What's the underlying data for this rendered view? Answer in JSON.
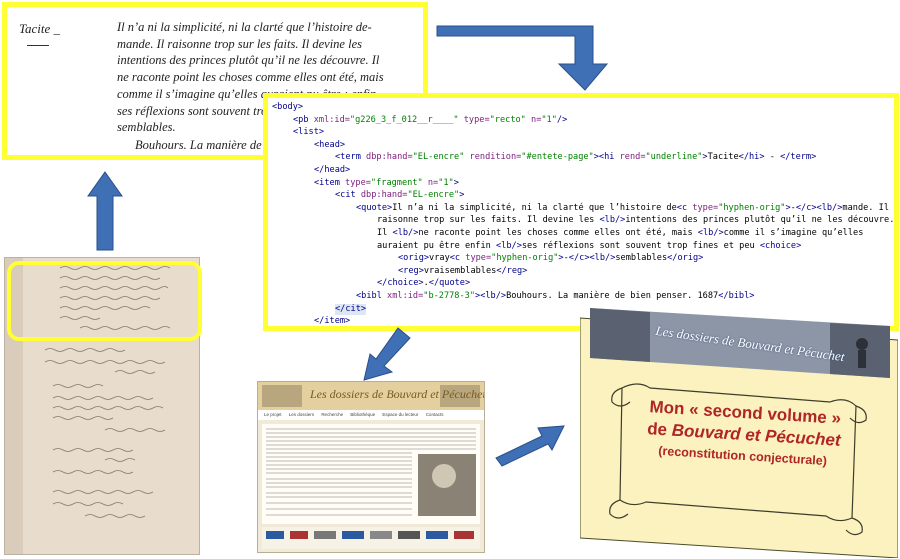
{
  "transcription": {
    "heading": "Tacite _",
    "lines": [
      "Il n’a ni la simplicité, ni la clarté que l’histoire de-",
      "mande. Il raisonne trop sur les faits. Il devine les",
      "intentions des princes plutôt qu’il ne les découvre. Il",
      "ne raconte point les choses comme elles ont été, mais",
      "comme il s’imagine qu’elles auraient pu être ; enfin",
      "ses réflexions sont souvent trop fines et peu vrai-",
      "semblables."
    ],
    "signature": "Bouhours.    La manière de bien penser."
  },
  "xml": {
    "lines": [
      {
        "indent": 0,
        "parts": [
          [
            "tag",
            "<body>"
          ]
        ]
      },
      {
        "indent": 1,
        "parts": [
          [
            "tag",
            "<pb "
          ],
          [
            "an",
            "xml:id="
          ],
          [
            "av",
            "\"g226_3_f_012__r____\""
          ],
          [
            "an",
            " type="
          ],
          [
            "av",
            "\"recto\""
          ],
          [
            "an",
            " n="
          ],
          [
            "av",
            "\"1\""
          ],
          [
            "tag",
            "/>"
          ]
        ]
      },
      {
        "indent": 1,
        "parts": [
          [
            "tag",
            "<list>"
          ]
        ]
      },
      {
        "indent": 2,
        "parts": [
          [
            "tag",
            "<head>"
          ]
        ]
      },
      {
        "indent": 3,
        "parts": [
          [
            "tag",
            "<term "
          ],
          [
            "an",
            "dbp:hand="
          ],
          [
            "av",
            "\"EL-encre\""
          ],
          [
            "an",
            " rendition="
          ],
          [
            "av",
            "\"#entete-page\""
          ],
          [
            "tag",
            ">"
          ],
          [
            "tag",
            "<hi "
          ],
          [
            "an",
            "rend="
          ],
          [
            "av",
            "\"underline\""
          ],
          [
            "tag",
            ">"
          ],
          [
            "txt",
            "Tacite"
          ],
          [
            "tag",
            "</hi>"
          ],
          [
            "txt",
            " - "
          ],
          [
            "tag",
            "</term>"
          ]
        ]
      },
      {
        "indent": 2,
        "parts": [
          [
            "tag",
            "</head>"
          ]
        ]
      },
      {
        "indent": 2,
        "parts": [
          [
            "tag",
            "<item "
          ],
          [
            "an",
            "type="
          ],
          [
            "av",
            "\"fragment\""
          ],
          [
            "an",
            " n="
          ],
          [
            "av",
            "\"1\""
          ],
          [
            "tag",
            ">"
          ]
        ]
      },
      {
        "indent": 3,
        "parts": [
          [
            "tag",
            "<cit "
          ],
          [
            "an",
            "dbp:hand="
          ],
          [
            "av",
            "\"EL-encre\""
          ],
          [
            "tag",
            ">"
          ]
        ]
      },
      {
        "indent": 4,
        "parts": [
          [
            "tag",
            "<quote>"
          ],
          [
            "txt",
            "Il n’a ni la simplicité, ni la clarté que l’histoire de"
          ],
          [
            "tag",
            "<c "
          ],
          [
            "an",
            "type="
          ],
          [
            "av",
            "\"hyphen-orig\""
          ],
          [
            "tag",
            ">"
          ],
          [
            "txt",
            "-"
          ],
          [
            "tag",
            "</c><lb/>"
          ],
          [
            "txt",
            "mande. Il"
          ]
        ]
      },
      {
        "indent": 5,
        "parts": [
          [
            "txt",
            "raisonne trop sur les faits. Il devine les "
          ],
          [
            "tag",
            "<lb/>"
          ],
          [
            "txt",
            "intentions des princes plutôt qu’il ne les découvre."
          ]
        ]
      },
      {
        "indent": 5,
        "parts": [
          [
            "txt",
            "Il "
          ],
          [
            "tag",
            "<lb/>"
          ],
          [
            "txt",
            "ne raconte point les choses comme elles ont été, mais "
          ],
          [
            "tag",
            "<lb/>"
          ],
          [
            "txt",
            "comme il s’imagine qu’elles"
          ]
        ]
      },
      {
        "indent": 5,
        "parts": [
          [
            "txt",
            "auraient pu être enfin "
          ],
          [
            "tag",
            "<lb/>"
          ],
          [
            "txt",
            "ses réflexions sont souvent trop fines et peu "
          ],
          [
            "tag",
            "<choice>"
          ]
        ]
      },
      {
        "indent": 6,
        "parts": [
          [
            "tag",
            "<orig>"
          ],
          [
            "txt",
            "vray"
          ],
          [
            "tag",
            "<c "
          ],
          [
            "an",
            "type="
          ],
          [
            "av",
            "\"hyphen-orig\""
          ],
          [
            "tag",
            ">"
          ],
          [
            "txt",
            "-"
          ],
          [
            "tag",
            "</c><lb/>"
          ],
          [
            "txt",
            "semblables"
          ],
          [
            "tag",
            "</orig>"
          ]
        ]
      },
      {
        "indent": 6,
        "parts": [
          [
            "tag",
            "<reg>"
          ],
          [
            "txt",
            "vraisemblables"
          ],
          [
            "tag",
            "</reg>"
          ]
        ]
      },
      {
        "indent": 5,
        "parts": [
          [
            "tag",
            "</choice>"
          ],
          [
            "txt",
            "."
          ],
          [
            "tag",
            "</quote>"
          ]
        ]
      },
      {
        "indent": 4,
        "parts": [
          [
            "tag",
            "<bibl "
          ],
          [
            "an",
            "xml:id="
          ],
          [
            "av",
            "\"b-2778-3\""
          ],
          [
            "tag",
            ">"
          ],
          [
            "tag",
            "<lb/>"
          ],
          [
            "txt",
            "Bouhours. La manière de bien penser. 1687"
          ],
          [
            "tag",
            "</bibl>"
          ]
        ]
      },
      {
        "indent": 3,
        "parts": [
          [
            "tag",
            "</cit>"
          ]
        ],
        "selected": true
      },
      {
        "indent": 2,
        "parts": [
          [
            "tag",
            "</item>"
          ]
        ]
      }
    ]
  },
  "website": {
    "title": "Les dossiers de Bouvard et Pécuchet",
    "nav": [
      "Le projet",
      "Les dossiers",
      "Recherche",
      "Bibliothèque",
      "Espace du lecteur",
      "Contacts"
    ]
  },
  "poster": {
    "banner_title": "Les dossiers de Bouvard et Pécuchet",
    "line1": "Mon « second volume »",
    "line2_prefix": "de ",
    "line2_emphasis": "Bouvard et Pécuchet",
    "line3": "(reconstitution conjecturale)"
  },
  "colors": {
    "highlight": "#ffff33",
    "arrow": "#3f6fb5",
    "poster_text": "#b02525",
    "xml_tag": "#00008b",
    "xml_attr_name": "#7a1e7a",
    "xml_attr_value": "#008000"
  }
}
